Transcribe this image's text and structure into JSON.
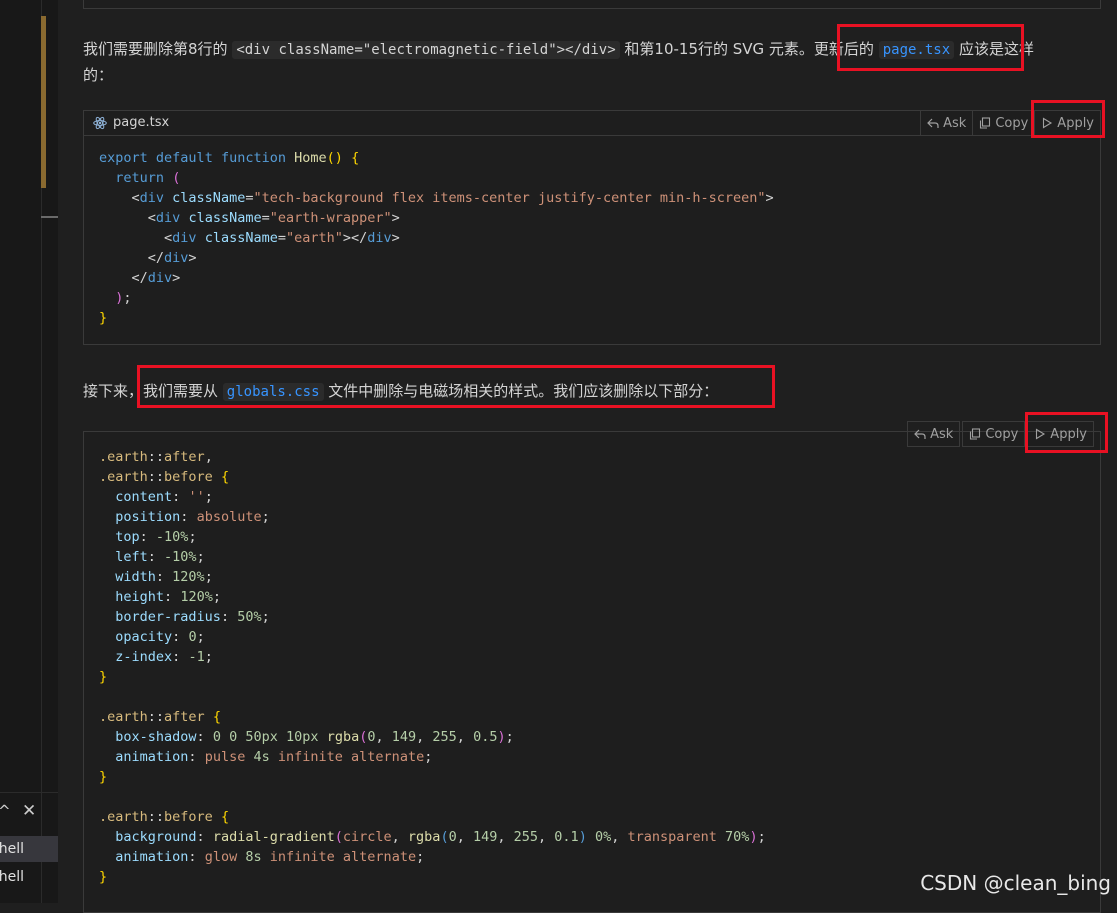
{
  "sidebar": {
    "terminal_items": [
      "hell",
      "hell"
    ]
  },
  "chat": {
    "para1": {
      "t1": "我们需要删除第8行的",
      "c1": "<div className=\"electromagnetic-field\"></div>",
      "t2": "和第10-15行的 SVG 元素。更新后的",
      "c2": "page.tsx",
      "t3": "应该是这样",
      "line2": "的："
    },
    "code1": {
      "filename": "page.tsx",
      "ask_label": "Ask",
      "copy_label": "Copy",
      "apply_label": "Apply"
    },
    "para2": {
      "t1": "接下来，我们需要从",
      "c1": "globals.css",
      "t2": "文件中删除与电磁场相关的样式。我们应该删除以下部分："
    },
    "code2": {
      "ask_label": "Ask",
      "copy_label": "Copy",
      "apply_label": "Apply"
    }
  },
  "watermark": "CSDN @clean_bing",
  "colors": {
    "highlight": "#e81123",
    "link": "#3794ff",
    "background": "#1f1f1f"
  }
}
